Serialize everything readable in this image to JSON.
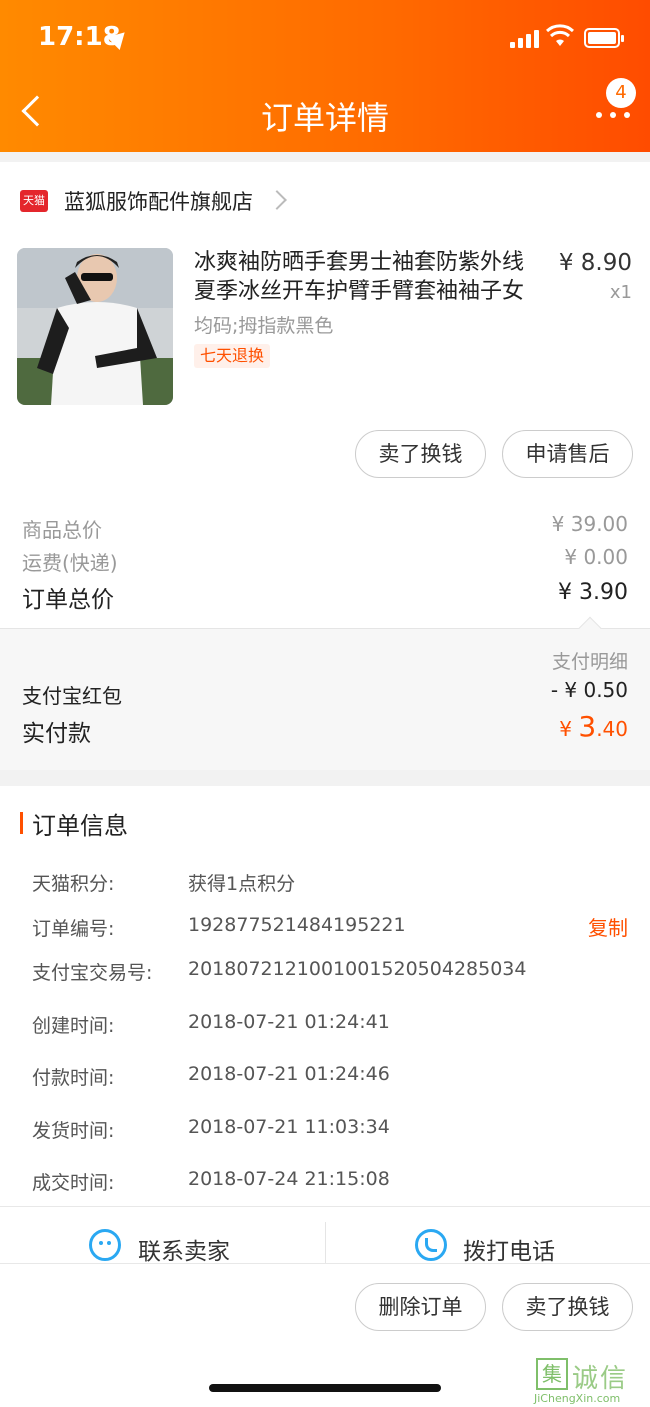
{
  "status_bar": {
    "time": "17:18"
  },
  "header": {
    "title": "订单详情",
    "badge_count": "4"
  },
  "shop": {
    "logo_text": "天猫",
    "name": "蓝狐服饰配件旗舰店"
  },
  "product": {
    "title_line1": "冰爽袖防晒手套男士袖套防紫外线",
    "title_line2": "夏季冰丝开车护臂手臂套袖袖子女",
    "price": "¥ 8.90",
    "qty": "x1",
    "spec": "均码;拇指款黑色",
    "tag": "七天退换"
  },
  "product_actions": {
    "sell": "卖了换钱",
    "after_sale": "申请售后"
  },
  "summary": {
    "goods_total_label": "商品总价",
    "goods_total": "¥ 39.00",
    "shipping_label": "运费(快递)",
    "shipping": "¥ 0.00",
    "order_total_label": "订单总价",
    "order_total": "¥ 3.90"
  },
  "payment": {
    "detail_link": "支付明细",
    "red_packet_label": "支付宝红包",
    "red_packet": "- ¥ 0.50",
    "paid_label": "实付款",
    "paid_symbol": "¥ ",
    "paid_int": "3",
    "paid_dec": ".40"
  },
  "order_info": {
    "title": "订单信息",
    "points_label": "天猫积分:",
    "points": "获得1点积分",
    "order_no_label": "订单编号:",
    "order_no": "192877521484195221",
    "copy": "复制",
    "alipay_label": "支付宝交易号:",
    "alipay_no": "2018072121001001520504285034",
    "created_label": "创建时间:",
    "created": "2018-07-21 01:24:41",
    "paid_time_label": "付款时间:",
    "paid_time": "2018-07-21 01:24:46",
    "shipped_label": "发货时间:",
    "shipped": "2018-07-21 11:03:34",
    "closed_label": "成交时间:",
    "closed": "2018-07-24 21:15:08"
  },
  "contact": {
    "seller": "联系卖家",
    "call": "拨打电话"
  },
  "bottom_actions": {
    "delete": "删除订单",
    "sell": "卖了换钱"
  },
  "watermark": {
    "char": "集",
    "text": "诚信",
    "sub": "JiChengXin.com"
  },
  "colors": {
    "accent": "#ff5000",
    "header_start": "#ff8a00",
    "header_end": "#ff4c00",
    "link_blue": "#2aa8f2"
  }
}
